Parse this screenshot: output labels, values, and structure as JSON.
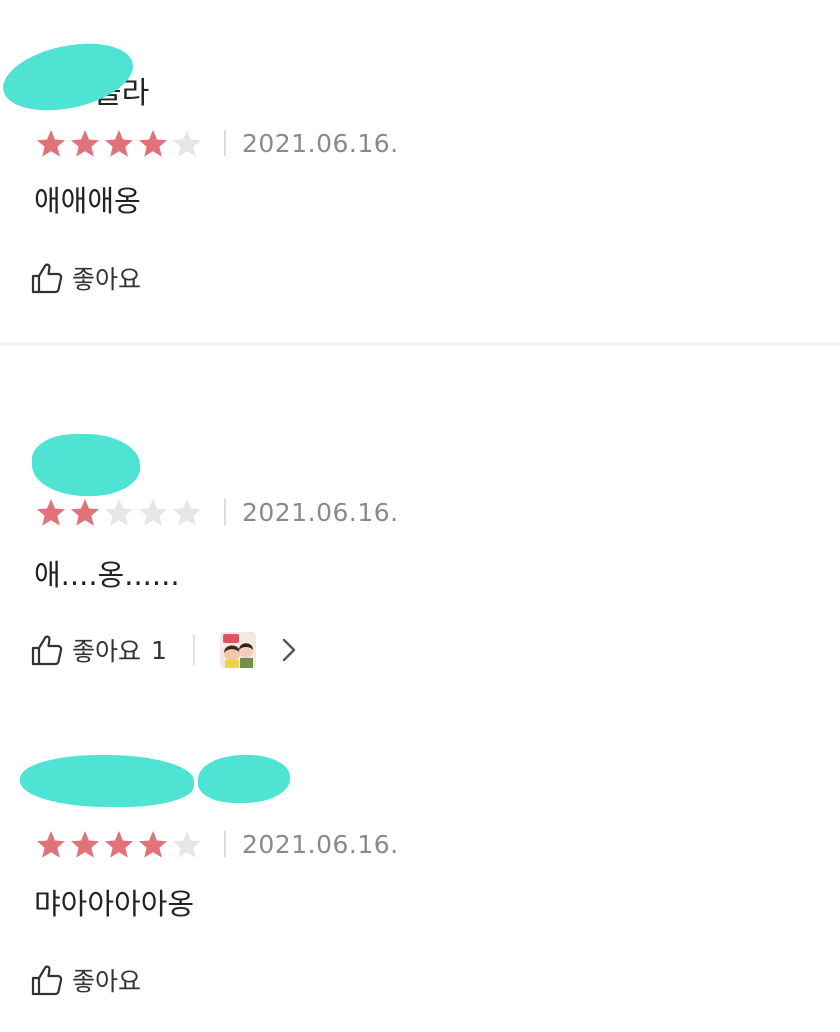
{
  "reviews": [
    {
      "author_visible": "을라",
      "rating": 4,
      "max_rating": 5,
      "date": "2021.06.16.",
      "body": "애애애옹",
      "like_label": "좋아요",
      "like_count": null
    },
    {
      "author_visible": "",
      "rating": 2,
      "max_rating": 5,
      "date": "2021.06.16.",
      "body": "애....옹......",
      "like_label": "좋아요",
      "like_count": "1"
    },
    {
      "author_visible": "",
      "rating": 4,
      "max_rating": 5,
      "date": "2021.06.16.",
      "body": "먀아아아아옹",
      "like_label": "좋아요",
      "like_count": null
    }
  ],
  "colors": {
    "star_filled": "#e0737a",
    "star_empty": "#e6e6e6",
    "redaction": "#4fe3d3",
    "date": "#8a8a8a"
  },
  "icons": {
    "like": "thumbs-up-icon",
    "star": "star-icon",
    "reply_sticker": "sticker-thumbnail",
    "more": "chevron-right-icon"
  }
}
